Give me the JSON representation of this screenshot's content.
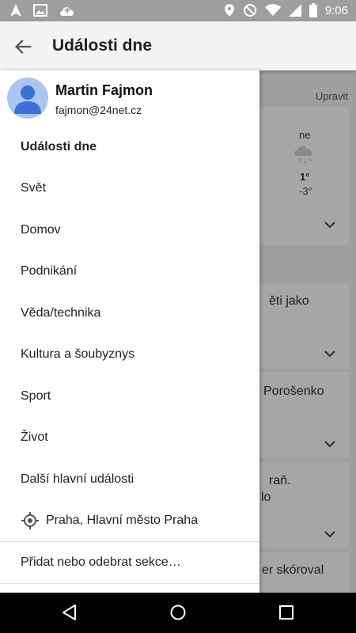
{
  "status_bar": {
    "time": "9:06",
    "icons_left": [
      "navigation-icon",
      "image-icon",
      "cloud-upload-icon"
    ],
    "icons_right": [
      "location-icon",
      "do-not-disturb-icon",
      "wifi-icon",
      "signal-icon",
      "battery-icon"
    ]
  },
  "appbar": {
    "title": "Události dne"
  },
  "background": {
    "edit_label": "Upravit",
    "weather": {
      "day": "ne",
      "high": "1°",
      "low": "-3°"
    },
    "cards": [
      "ěti jako",
      "Porošenko",
      "raň.",
      "lo",
      "er skóroval"
    ]
  },
  "drawer": {
    "user": {
      "name": "Martin Fajmon",
      "email": "fajmon@24net.cz"
    },
    "items": [
      {
        "label": "Události dne",
        "active": true
      },
      {
        "label": "Svět"
      },
      {
        "label": "Domov"
      },
      {
        "label": "Podnikání"
      },
      {
        "label": "Věda/technika"
      },
      {
        "label": "Kultura a šoubyznys"
      },
      {
        "label": "Sport"
      },
      {
        "label": "Život"
      },
      {
        "label": "Další hlavní události"
      }
    ],
    "location": "Praha, Hlavní město Praha",
    "add_remove": "Přidat nebo odebrat sekce…"
  },
  "colors": {
    "accent": "#4a7fd8",
    "scrim": "#9f9f9f",
    "drawer_bg": "#ffffff"
  }
}
